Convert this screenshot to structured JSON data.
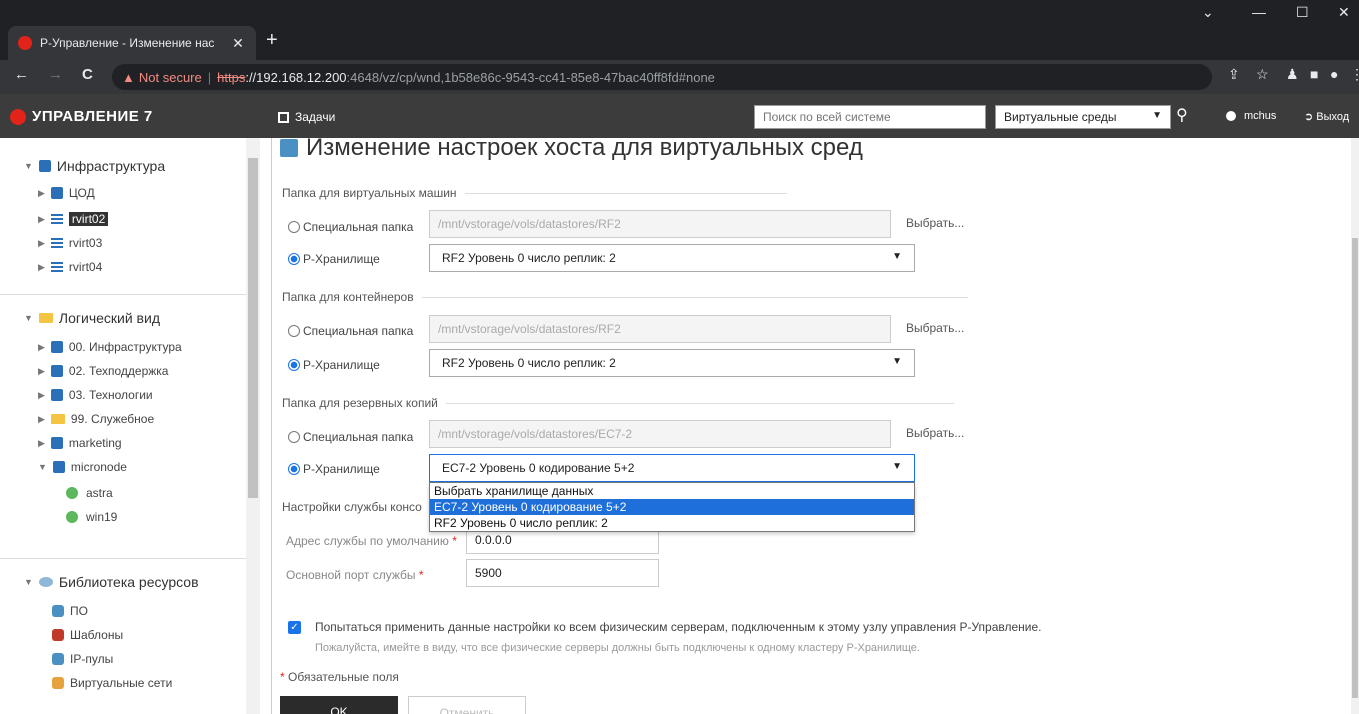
{
  "browser": {
    "tab_title": "Р-Управление - Изменение нас",
    "tab_close": "✕",
    "new_tab": "+",
    "url_warning": "Not secure",
    "url_scheme": "https",
    "url_host": "://192.168.12.200",
    "url_rest": ":4648/vz/cp/wnd,1b58e86c-9543-cc41-85e8-47bac40ff8fd#none",
    "back": "←",
    "forward": "→",
    "reload": "C",
    "minimize": "—",
    "maximize": "☐",
    "close": "✕",
    "collapse": "⌄"
  },
  "header": {
    "logo": "УПРАВЛЕНИЕ 7",
    "tasks": "Задачи",
    "search_placeholder": "Поиск по всей системе",
    "scope": "Виртуальные среды",
    "user": "mchus",
    "logout": "Выход"
  },
  "sidebar": {
    "infra": {
      "title": "Инфраструктура",
      "items": [
        "ЦОД",
        "rvirt02",
        "rvirt03",
        "rvirt04"
      ]
    },
    "logical": {
      "title": "Логический вид",
      "items": [
        "00. Инфраструктура",
        "02. Техподдержка",
        "03. Технологии",
        "99. Служебное",
        "marketing",
        "micronode"
      ],
      "vms": [
        "astra",
        "win19"
      ]
    },
    "library": {
      "title": "Библиотека ресурсов",
      "items": [
        "ПО",
        "Шаблоны",
        "IP-пулы",
        "Виртуальные сети"
      ]
    }
  },
  "main": {
    "title": "Изменение настроек хоста для виртуальных сред",
    "vm_folder": {
      "legend": "Папка для виртуальных машин",
      "custom_label": "Специальная папка",
      "path": "/mnt/vstorage/vols/datastores/RF2",
      "choose": "Выбрать...",
      "storage_label": "Р-Хранилище",
      "storage_value": "RF2 Уровень 0 число реплик: 2"
    },
    "ct_folder": {
      "legend": "Папка для контейнеров",
      "custom_label": "Специальная папка",
      "path": "/mnt/vstorage/vols/datastores/RF2",
      "choose": "Выбрать...",
      "storage_label": "Р-Хранилище",
      "storage_value": "RF2 Уровень 0 число реплик: 2"
    },
    "backup_folder": {
      "legend": "Папка для резервных копий",
      "custom_label": "Специальная папка",
      "path": "/mnt/vstorage/vols/datastores/EC7-2",
      "choose": "Выбрать...",
      "storage_label": "Р-Хранилище",
      "storage_value": "EC7-2 Уровень 0 кодирование 5+2"
    },
    "dropdown_options": [
      "Выбрать хранилище данных",
      "EC7-2 Уровень 0 кодирование 5+2",
      "RF2 Уровень 0 число реплик: 2"
    ],
    "console": {
      "legend": "Настройки службы консо",
      "address_label": "Адрес службы по умолчанию",
      "address_value": "0.0.0.0",
      "port_label": "Основной порт службы",
      "port_value": "5900"
    },
    "apply_all": "Попытаться применить данные настройки ко всем физическим серверам, подключенным к этому узлу управления Р-Управление.",
    "apply_note": "Пожалуйста, имейте в виду, что все физические серверы должны быть подключены к одному кластеру Р-Хранилище.",
    "required_note": "Обязательные поля",
    "required_mark": "*",
    "ok": "OK",
    "cancel": "Отменить"
  },
  "colors": {
    "accent": "#1a73e8",
    "brand": "#e2231a",
    "header_bg": "#3c3c3c"
  }
}
